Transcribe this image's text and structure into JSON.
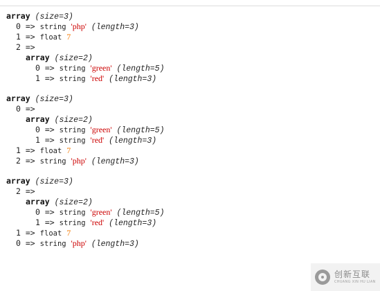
{
  "dump": {
    "blocks": [
      {
        "header": {
          "label": "array",
          "meta": "(size=3)"
        },
        "rows": [
          {
            "key": "0",
            "arrow": "=>",
            "type": "string",
            "value": "'php'",
            "meta": "(length=3)"
          },
          {
            "key": "1",
            "arrow": "=>",
            "type": "float",
            "value": "7"
          },
          {
            "key": "2",
            "arrow": "=>",
            "nested": {
              "label": "array",
              "meta": "(size=2)",
              "rows": [
                {
                  "key": "0",
                  "arrow": "=>",
                  "type": "string",
                  "value": "'green'",
                  "meta": "(length=5)"
                },
                {
                  "key": "1",
                  "arrow": "=>",
                  "type": "string",
                  "value": "'red'",
                  "meta": "(length=3)"
                }
              ]
            }
          }
        ]
      },
      {
        "header": {
          "label": "array",
          "meta": "(size=3)"
        },
        "rows": [
          {
            "key": "0",
            "arrow": "=>",
            "nested": {
              "label": "array",
              "meta": "(size=2)",
              "rows": [
                {
                  "key": "0",
                  "arrow": "=>",
                  "type": "string",
                  "value": "'green'",
                  "meta": "(length=5)"
                },
                {
                  "key": "1",
                  "arrow": "=>",
                  "type": "string",
                  "value": "'red'",
                  "meta": "(length=3)"
                }
              ]
            }
          },
          {
            "key": "1",
            "arrow": "=>",
            "type": "float",
            "value": "7"
          },
          {
            "key": "2",
            "arrow": "=>",
            "type": "string",
            "value": "'php'",
            "meta": "(length=3)"
          }
        ]
      },
      {
        "header": {
          "label": "array",
          "meta": "(size=3)"
        },
        "rows": [
          {
            "key": "2",
            "arrow": "=>",
            "nested": {
              "label": "array",
              "meta": "(size=2)",
              "rows": [
                {
                  "key": "0",
                  "arrow": "=>",
                  "type": "string",
                  "value": "'green'",
                  "meta": "(length=5)"
                },
                {
                  "key": "1",
                  "arrow": "=>",
                  "type": "string",
                  "value": "'red'",
                  "meta": "(length=3)"
                }
              ]
            }
          },
          {
            "key": "1",
            "arrow": "=>",
            "type": "float",
            "value": "7"
          },
          {
            "key": "0",
            "arrow": "=>",
            "type": "string",
            "value": "'php'",
            "meta": "(length=3)"
          }
        ]
      }
    ]
  },
  "watermark": {
    "main": "创新互联",
    "sub": "CHUANG XIN HU LIAN",
    "logo_icon": "cx-logo-icon"
  },
  "colors": {
    "string": "#cc0000",
    "float": "#f57900",
    "text": "#222222",
    "background": "#ffffff"
  }
}
